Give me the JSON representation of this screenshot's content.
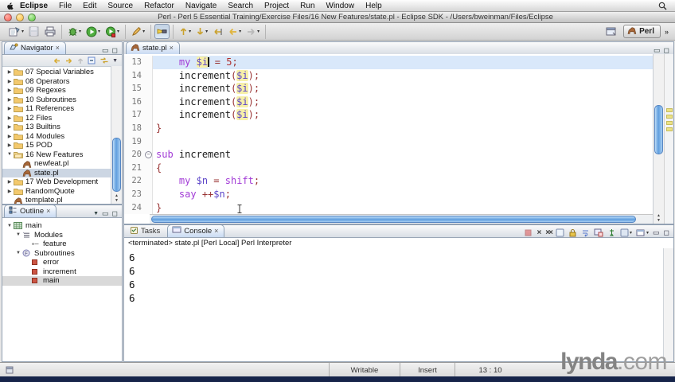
{
  "menubar": {
    "items": [
      "Eclipse",
      "File",
      "Edit",
      "Source",
      "Refactor",
      "Navigate",
      "Search",
      "Project",
      "Run",
      "Window",
      "Help"
    ]
  },
  "titlebar": {
    "title": "Perl - Perl 5 Essential Training/Exercise Files/16 New Features/state.pl - Eclipse SDK - /Users/bweinman/Files/Eclipse"
  },
  "toolbar": {
    "groups": [
      {
        "icons": [
          {
            "name": "new-wizard",
            "type": "new",
            "dd": true
          },
          {
            "name": "save",
            "type": "save",
            "disabled": true
          },
          {
            "name": "print",
            "type": "print"
          }
        ]
      },
      {
        "icons": [
          {
            "name": "debug",
            "type": "debug",
            "dd": true
          },
          {
            "name": "run",
            "type": "run",
            "dd": true
          },
          {
            "name": "external-tools",
            "type": "runext",
            "dd": true
          }
        ]
      },
      {
        "icons": [
          {
            "name": "new-marker",
            "type": "pencil",
            "dd": true
          }
        ]
      },
      {
        "icons": [
          {
            "name": "mark-occurrences",
            "type": "torch",
            "pressed": true
          }
        ]
      },
      {
        "icons": [
          {
            "name": "next-annotation",
            "type": "nexta",
            "dd": true
          },
          {
            "name": "previous-annotation",
            "type": "preva",
            "dd": true
          },
          {
            "name": "last-edit-location",
            "type": "lastedit"
          },
          {
            "name": "back",
            "type": "back",
            "dd": true
          },
          {
            "name": "forward",
            "type": "fwd",
            "dd": true
          }
        ]
      }
    ],
    "perspective": {
      "label": "Perl",
      "overflow": "»"
    }
  },
  "navigator": {
    "title": "Navigator",
    "tools": [
      "back",
      "forward",
      "up",
      "collapse-all",
      "link-editor",
      "view-menu"
    ],
    "items": [
      {
        "label": "07 Special Variables",
        "icon": "folder",
        "arrow": "right",
        "depth": 0
      },
      {
        "label": "08 Operators",
        "icon": "folder",
        "arrow": "right",
        "depth": 0
      },
      {
        "label": "09 Regexes",
        "icon": "folder",
        "arrow": "right",
        "depth": 0
      },
      {
        "label": "10 Subroutines",
        "icon": "folder",
        "arrow": "right",
        "depth": 0
      },
      {
        "label": "11 References",
        "icon": "folder",
        "arrow": "right",
        "depth": 0
      },
      {
        "label": "12 Files",
        "icon": "folder",
        "arrow": "right",
        "depth": 0
      },
      {
        "label": "13 Builtins",
        "icon": "folder",
        "arrow": "right",
        "depth": 0
      },
      {
        "label": "14 Modules",
        "icon": "folder",
        "arrow": "right",
        "depth": 0
      },
      {
        "label": "15 POD",
        "icon": "folder",
        "arrow": "right",
        "depth": 0
      },
      {
        "label": "16 New Features",
        "icon": "folder-open",
        "arrow": "down",
        "depth": 0
      },
      {
        "label": "newfeat.pl",
        "icon": "perl",
        "depth": 1
      },
      {
        "label": "state.pl",
        "icon": "perl",
        "depth": 1,
        "selected": true
      },
      {
        "label": "17 Web Development",
        "icon": "folder",
        "arrow": "right",
        "depth": 0
      },
      {
        "label": "RandomQuote",
        "icon": "folder",
        "arrow": "right",
        "depth": 0
      },
      {
        "label": "template.pl",
        "icon": "perl",
        "depth": 0
      }
    ]
  },
  "outline": {
    "title": "Outline",
    "items": [
      {
        "label": "main",
        "icon": "grid",
        "arrow": "down",
        "depth": 0
      },
      {
        "label": "Modules",
        "icon": "modules",
        "arrow": "down",
        "depth": 1
      },
      {
        "label": "feature",
        "icon": "feature",
        "depth": 2
      },
      {
        "label": "Subroutines",
        "icon": "subs",
        "arrow": "down",
        "depth": 1
      },
      {
        "label": "error",
        "icon": "subitem",
        "depth": 2
      },
      {
        "label": "increment",
        "icon": "subitem",
        "depth": 2
      },
      {
        "label": "main",
        "icon": "subitem",
        "depth": 2,
        "selected": true
      }
    ]
  },
  "editor": {
    "tab_label": "state.pl",
    "lines": [
      {
        "num": "13",
        "current": true,
        "tokens": [
          [
            "    ",
            "pl"
          ],
          [
            "my",
            "kw"
          ],
          [
            " ",
            "pl"
          ],
          [
            "$i",
            "var occ"
          ],
          [
            "",
            "caret"
          ],
          [
            " ",
            "pl"
          ],
          [
            "=",
            "op"
          ],
          [
            " ",
            "pl"
          ],
          [
            "5",
            "num"
          ],
          [
            ";",
            "op"
          ]
        ]
      },
      {
        "num": "14",
        "tokens": [
          [
            "    ",
            "pl"
          ],
          [
            "increment",
            "pl"
          ],
          [
            "(",
            "op"
          ],
          [
            "$i",
            "var occ"
          ],
          [
            ")",
            "op"
          ],
          [
            ";",
            "op"
          ]
        ]
      },
      {
        "num": "15",
        "tokens": [
          [
            "    ",
            "pl"
          ],
          [
            "increment",
            "pl"
          ],
          [
            "(",
            "op"
          ],
          [
            "$i",
            "var occ"
          ],
          [
            ")",
            "op"
          ],
          [
            ";",
            "op"
          ]
        ]
      },
      {
        "num": "16",
        "tokens": [
          [
            "    ",
            "pl"
          ],
          [
            "increment",
            "pl"
          ],
          [
            "(",
            "op"
          ],
          [
            "$i",
            "var occ"
          ],
          [
            ")",
            "op"
          ],
          [
            ";",
            "op"
          ]
        ]
      },
      {
        "num": "17",
        "tokens": [
          [
            "    ",
            "pl"
          ],
          [
            "increment",
            "pl"
          ],
          [
            "(",
            "op"
          ],
          [
            "$i",
            "var occ"
          ],
          [
            ")",
            "op"
          ],
          [
            ";",
            "op"
          ]
        ]
      },
      {
        "num": "18",
        "tokens": [
          [
            "}",
            "op"
          ]
        ]
      },
      {
        "num": "19",
        "tokens": []
      },
      {
        "num": "20",
        "fold": true,
        "tokens": [
          [
            "sub",
            "kw"
          ],
          [
            " ",
            "pl"
          ],
          [
            "increment",
            "pl"
          ]
        ]
      },
      {
        "num": "21",
        "tokens": [
          [
            "{",
            "op"
          ]
        ]
      },
      {
        "num": "22",
        "tokens": [
          [
            "    ",
            "pl"
          ],
          [
            "my",
            "kw"
          ],
          [
            " ",
            "pl"
          ],
          [
            "$n",
            "var"
          ],
          [
            " ",
            "pl"
          ],
          [
            "=",
            "op"
          ],
          [
            " ",
            "pl"
          ],
          [
            "shift",
            "kw"
          ],
          [
            ";",
            "op"
          ]
        ]
      },
      {
        "num": "23",
        "tokens": [
          [
            "    ",
            "pl"
          ],
          [
            "say",
            "kw"
          ],
          [
            " ",
            "pl"
          ],
          [
            "++",
            "op"
          ],
          [
            "$n",
            "var"
          ],
          [
            ";",
            "op"
          ]
        ]
      },
      {
        "num": "24",
        "tokens": [
          [
            "}",
            "op"
          ]
        ]
      }
    ]
  },
  "console": {
    "tabs": [
      {
        "label": "Tasks"
      },
      {
        "label": "Console",
        "active": true
      }
    ],
    "tools": [
      "terminate",
      "remove-launch",
      "remove-all-terminated",
      "clear-console",
      "scroll-lock",
      "word-wrap",
      "show-on-stdout",
      "pin-console",
      "display-selected-console",
      "open-console",
      "minimize",
      "maximize"
    ],
    "status": "<terminated> state.pl [Perl Local] Perl Interpreter",
    "output": [
      "6",
      "6",
      "6",
      "6"
    ]
  },
  "statusbar": {
    "cells": [
      "Writable",
      "Insert",
      "13 : 10"
    ]
  },
  "watermark": {
    "brand": "lynda",
    "suffix": ".com"
  },
  "colors": {
    "keyword": "#a23bd6",
    "variable": "#5b44c8",
    "operator": "#993333",
    "occurrence": "#f7f0a8",
    "current_line": "#d9e8fa"
  }
}
